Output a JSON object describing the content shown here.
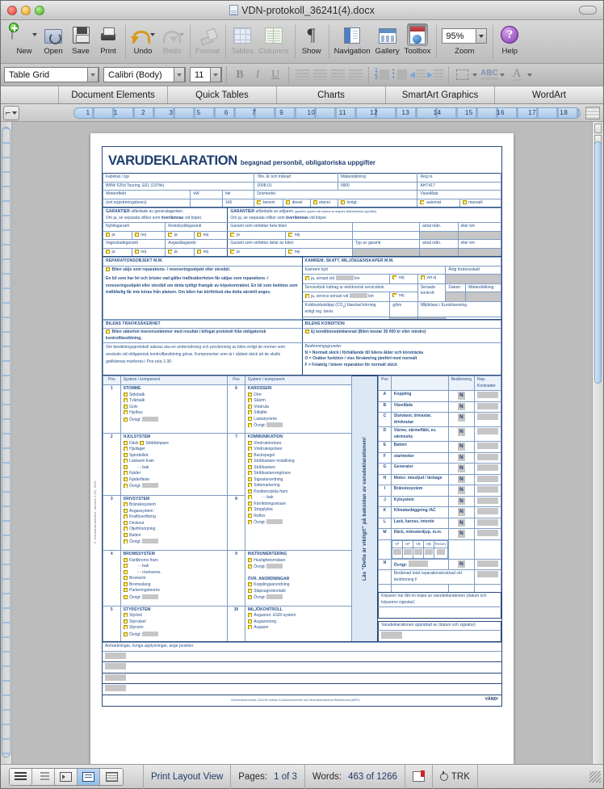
{
  "window": {
    "title": "VDN-protokoll_36241(4).docx"
  },
  "toolbar": {
    "buttons": [
      {
        "label": "New",
        "icon": "new-document-icon",
        "enabled": true,
        "has_menu": true
      },
      {
        "label": "Open",
        "icon": "open-folder-icon",
        "enabled": true,
        "has_menu": false
      },
      {
        "label": "Save",
        "icon": "save-disk-icon",
        "enabled": true,
        "has_menu": false
      },
      {
        "label": "Print",
        "icon": "printer-icon",
        "enabled": true,
        "has_menu": false
      },
      {
        "label": "Undo",
        "icon": "undo-arrow-icon",
        "enabled": true,
        "has_menu": true
      },
      {
        "label": "Redo",
        "icon": "redo-arrow-icon",
        "enabled": false,
        "has_menu": true
      },
      {
        "label": "Format",
        "icon": "format-brush-icon",
        "enabled": false,
        "has_menu": false
      },
      {
        "label": "Tables",
        "icon": "table-grid-icon",
        "enabled": false,
        "has_menu": false
      },
      {
        "label": "Columns",
        "icon": "columns-icon",
        "enabled": false,
        "has_menu": false
      },
      {
        "label": "Show",
        "icon": "pilcrow-icon",
        "enabled": true,
        "has_menu": false
      },
      {
        "label": "Navigation",
        "icon": "navigation-pane-icon",
        "enabled": true,
        "has_menu": false
      },
      {
        "label": "Gallery",
        "icon": "gallery-icon",
        "enabled": true,
        "has_menu": false
      },
      {
        "label": "Toolbox",
        "icon": "toolbox-icon",
        "enabled": true,
        "has_menu": false
      },
      {
        "label": "Zoom",
        "icon": "zoom-icon",
        "enabled": true,
        "has_menu": false
      },
      {
        "label": "Help",
        "icon": "help-circle-icon",
        "enabled": true,
        "has_menu": false
      }
    ],
    "zoom_value": "95%"
  },
  "formatbar": {
    "style": "Table Grid",
    "font": "Calibri (Body)",
    "size": "11",
    "bold": "B",
    "italic": "I",
    "underline": "U"
  },
  "gallery_tabs": [
    {
      "label": "Document Elements"
    },
    {
      "label": "Quick Tables"
    },
    {
      "label": "Charts"
    },
    {
      "label": "SmartArt Graphics"
    },
    {
      "label": "WordArt"
    }
  ],
  "ruler": {
    "numbers": [
      "1",
      "1",
      "2",
      "3",
      "5",
      "6",
      "7",
      "9",
      "10",
      "11",
      "12",
      "13",
      "14",
      "15",
      "16",
      "17",
      "18"
    ]
  },
  "document": {
    "copyright_side": "© Konsumentverket, version 1.02, 2011",
    "title_main": "VARUDEKLARATION",
    "title_sub": "begagnad personbil, obligatoriska uppgifter",
    "vehicle": {
      "fabrikat_label": "Fabrikat / typ",
      "fabrikat_value": "BMW 525d Touring, E61 (197hk)",
      "year_label": "Tillv. år och månad",
      "year_value": "2008-01",
      "meter_label": "Mätarställning",
      "meter_value": "9900",
      "reg_label": "Reg.nr.",
      "reg_value": "AHT417",
      "power_label": "Motoreffekt",
      "power_sublabel": "(enl.registreringsbevis)",
      "kw_label": "kW",
      "hk_label": "hkr",
      "hk_value": "145",
      "fuel_label": "Drivmedel",
      "fuel_options": [
        "bensin",
        "diesel",
        "etanol",
        "övrigt:"
      ],
      "gearbox_label": "Växellåda",
      "gearbox_options": [
        "automat",
        "manuell"
      ]
    },
    "guarantees": {
      "left_head_bold": "GARANTIER",
      "left_head_rest": "utfärdade av generalagenten.",
      "left_line2_a": "Om ja, se separata villkor som ",
      "left_line2_b": "överlämnas",
      "left_line2_c": " vid köpet.",
      "right_head_bold": "GARANTIER",
      "right_head_rest": "utfärdade av säljaren",
      "right_head_paren": "(garantin upphör när endera av angiven tid/körsträcka uppnåtts).",
      "right_line2_a": "Om ja, se separata villkor som ",
      "right_line2_b": "överlämnas",
      "right_line2_c": " vid köpet.",
      "rows_left": [
        {
          "label": "Nybilsgaranti",
          "yes": "ja",
          "no": "nej"
        },
        {
          "label": "Rostskyddsgaranti",
          "yes": "ja",
          "no": "nej"
        },
        {
          "label": "Vagnskadegaranti",
          "yes": "ja",
          "no": "nej"
        },
        {
          "label": "Avgasåtagande",
          "yes": "ja",
          "no": "nej"
        }
      ],
      "rows_right": [
        {
          "label": "Garanti som omfattar hela bilen",
          "yes": "ja",
          "no": "nej",
          "type_label": "",
          "months": "antal mån.",
          "km": "eller km"
        },
        {
          "label": "Garanti som omfattar delar av bilen",
          "yes": "ja",
          "no": "nej",
          "type_label": "Typ av garanti",
          "months": "antal mån.",
          "km": "eller km"
        }
      ]
    },
    "repair": {
      "heading": "REPARATIONSOBJEKT M.M.",
      "checkbox_text": "Bilen säljs som reparations- / renoveringsobjekt eller skrotbil.",
      "paragraph": "En bil som har fel och brister vad gäller trafiksäkerheten får säljas som reparations- / renoveringsobjekt eller skrotbil om detta tydligt framgår av köpekontraktet. En bil som bedöms som trafikfarlig får inte köras från platsen. Om bilen har körförbud ska detta särskilt anges."
    },
    "kamrem": {
      "heading": "KAMREM, SKATT, MILJÖEGENSKAPER M.M.",
      "row1_label": "Kamrem bytt",
      "row1_check": "ja, senast vid",
      "row1_unit": "km",
      "row1_no": "nej",
      "row1_unknown": "vet ej",
      "tax_label": "Årlig fordonsskatt",
      "row2_label": "Servicebok /utdrag ur elektronisk servicebok",
      "row2_check": "ja, service senast vid",
      "row2_unit": "km",
      "row2_no": "nej",
      "control_label": "Senaste kontroll-",
      "date_label": "Datum",
      "meter_label": "Mätarställning",
      "co2_label_a": "Koldioxidutsläpp (CO",
      "co2_label_sub": "2",
      "co2_label_b": ") blandad körning",
      "co2_label_c": "enligt reg. bevis",
      "co2_unit": "g/km",
      "env_label": "Miljöklass / Euroklassning"
    },
    "safety": {
      "heading": "BILENS TRAFIKSÄKERHET",
      "checkbox_text": "Bilen säkerhet överensstämmer med resultat i bifogat protokoll från obligatorisk kontrollbesiktning.",
      "paragraph": "Om besiktningsprotokoll saknas ska en undersökning och provkörning av bilen enligt de normer som används vid obligatorisk kontrollbesiktning göras. Komponenter som är i sådant skick att de skulle godkännas markeras i Pos-ruta 1-30."
    },
    "condition": {
      "heading": "BILENS KONDITION",
      "checkbox_text": "Ej konditionsdeklarerad (Bilen kostar 30 000 kr eller mindre)",
      "legend_title": "Bedömningsgrunder",
      "legend": [
        "N = Normalt skick i förhållande till bilens ålder och körsträcka",
        "O = Osäker funktion / viss försämring jämfört med normalt",
        "F = Felaktig / kräver reparation för normalt skick"
      ]
    },
    "vertical_note": "Läs \"Detta är viktigt!\" på baksidan av varudeklarationen!",
    "syscols": {
      "header_pos": "Pos",
      "header_sys": "System / komponent",
      "left_groups": [
        {
          "pos": "1",
          "name": "STOMME",
          "items": [
            "Sidobalk",
            "Tvärbalk",
            "Golv",
            "Hjulhus",
            "Övrigt:"
          ],
          "last_fill": true
        },
        {
          "pos": "2",
          "name": "HJULSYSTEM",
          "items": [
            "Däck",
            "Hjullager",
            "Spindelled",
            "Länkarm fram",
            "- - bak",
            "Fjäder",
            "Fjäderfäste",
            "Övrigt:"
          ],
          "inline_extra": "Stötdämpare",
          "last_fill": true
        },
        {
          "pos": "3",
          "name": "DRIVSYSTEM",
          "items": [
            "Bränslesystem",
            "Avgassystem",
            "Kraftöverföring",
            "Drivknut",
            "Oljeförsörjning",
            "Batteri",
            "Övrigt:"
          ],
          "last_fill": true
        },
        {
          "pos": "4",
          "name": "BROMSSYSTEM",
          "items": [
            "Färdbroms fram",
            "- - bak",
            "- - rörelseres.",
            "Bromsrör",
            "Bromsslang",
            "Parkeringsbroms",
            "Övrigt:"
          ],
          "last_fill": true
        },
        {
          "pos": "5",
          "name": "STYRSYSTEM",
          "items": [
            "Styrled",
            "Styrväxel",
            "Styrarm",
            "Övrigt:"
          ],
          "last_fill": true
        }
      ],
      "right_groups": [
        {
          "pos": "6",
          "name": "KAROSSERI",
          "items": [
            "Dörr",
            "Skärm",
            "Vindruta",
            "Silbälte",
            "Lastutrymme",
            "Övrigt:"
          ],
          "last_fill": true
        },
        {
          "pos": "7",
          "name": "KOMMUNIKATION",
          "items": [
            "Vindrutetorkare",
            "Vindrutespolare",
            "Backspegel",
            "Strålkastare inställning",
            "Strålkastare",
            "Strålkastarrengörare",
            "Signalanordning",
            "Sidomarkering",
            "Positionslykta fram",
            "- - bak",
            "Körriktningsvisare",
            "Stopplykta",
            "Reflex",
            "Övrigt:"
          ],
          "last_fill": true
        },
        {
          "pos": "8",
          "name": "INSTRUMENTERING",
          "items": [
            "Hastighetsmätare",
            "Övrigt:"
          ],
          "last_fill": true
        },
        {
          "pos": "9",
          "name": "ÖVR. ANORDNINGAR",
          "items": [
            "Kopplingsanordning",
            "Släpvagnskontakt",
            "Övrigt:"
          ],
          "last_fill": true
        },
        {
          "pos": "30",
          "name": "MILJÖKONTROLL",
          "items": [
            "Avgasren. EGR-system",
            "Avgasrening",
            "Avgaser"
          ],
          "last_fill": false
        }
      ]
    },
    "assessment": {
      "header_pos": "Pos",
      "header_blank": "",
      "header_grade": "Bedömning",
      "header_cost": "Rep. Kostnader",
      "rows": [
        {
          "pos": "A",
          "name": "Koppling",
          "grade": "N"
        },
        {
          "pos": "B",
          "name": "Växellåda",
          "grade": "N"
        },
        {
          "pos": "C",
          "name": "Slutväxel, drivaxlar, drivknutar",
          "grade": "N"
        },
        {
          "pos": "D",
          "name": "Värme, värmefläkt, ev. värmesits",
          "grade": "N"
        },
        {
          "pos": "E",
          "name": "Batteri",
          "grade": "N"
        },
        {
          "pos": "F",
          "name": "startmotor",
          "grade": "N"
        },
        {
          "pos": "G",
          "name": "Generator",
          "grade": "N"
        },
        {
          "pos": "H",
          "name": "Motor: missljud / läckage",
          "grade": "N"
        },
        {
          "pos": "I",
          "name": "Bränslesystem",
          "grade": "N"
        },
        {
          "pos": "J",
          "name": "Kylsystem",
          "grade": "N"
        },
        {
          "pos": "K",
          "name": "Klimatanläggning /AC",
          "grade": "N"
        },
        {
          "pos": "L",
          "name": "Lack, kaross, interiör",
          "grade": "N"
        },
        {
          "pos": "M",
          "name": "Däck, mönsterdjup, m.m.",
          "grade": "N"
        }
      ],
      "tyre_headers": [
        "VF",
        "HF",
        "VB",
        "HB",
        "Reserv"
      ],
      "row_n": {
        "pos": "N",
        "name": "Övrigt:",
        "grade": "N"
      },
      "total_label": "Beräknad total reparationskostnad vid bedömning F"
    },
    "signatures": {
      "buyer_label": "Köparen har fått en kopia av varudeklarationen (datum och köparens signatur)",
      "seller_label": "Varudeklarationen upprättad av (datum och signatur)"
    },
    "notes": {
      "label": "Anmärkningar, övriga upplysningar, ange position."
    },
    "footer": {
      "text": "Överenskommelse 2011/02 mellan Konsumentverket och Motorbranschens Riksförbund (MRF)",
      "turn": "VÄND!"
    }
  },
  "statusbar": {
    "view_label": "Print Layout View",
    "pages_key": "Pages:",
    "pages_value": "1 of 3",
    "words_key": "Words:",
    "words_value": "463 of 1266",
    "track_label": "TRK"
  }
}
